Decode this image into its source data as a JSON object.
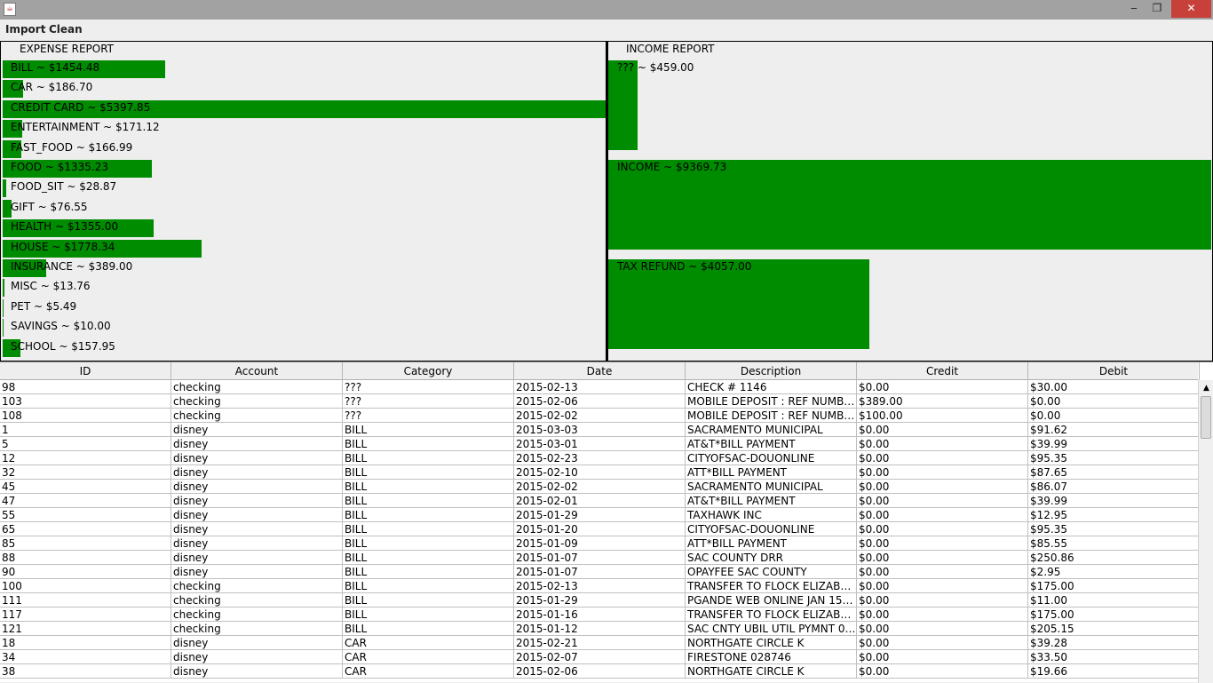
{
  "window": {
    "icon": "java-icon",
    "minimize": "‒",
    "maximize": "❐",
    "close": "✕"
  },
  "menu": [
    "Import",
    "Clean"
  ],
  "expense_report": {
    "title": "EXPENSE REPORT",
    "items": [
      {
        "label": "BILL ~ $1454.48",
        "value": 1454.48
      },
      {
        "label": "CAR ~ $186.70",
        "value": 186.7
      },
      {
        "label": "CREDIT CARD ~ $5397.85",
        "value": 5397.85
      },
      {
        "label": "ENTERTAINMENT ~ $171.12",
        "value": 171.12
      },
      {
        "label": "FAST_FOOD ~ $166.99",
        "value": 166.99
      },
      {
        "label": "FOOD ~ $1335.23",
        "value": 1335.23
      },
      {
        "label": "FOOD_SIT ~ $28.87",
        "value": 28.87
      },
      {
        "label": "GIFT ~ $76.55",
        "value": 76.55
      },
      {
        "label": "HEALTH ~ $1355.00",
        "value": 1355.0
      },
      {
        "label": "HOUSE ~ $1778.34",
        "value": 1778.34
      },
      {
        "label": "INSURANCE ~ $389.00",
        "value": 389.0
      },
      {
        "label": "MISC ~ $13.76",
        "value": 13.76
      },
      {
        "label": "PET ~ $5.49",
        "value": 5.49
      },
      {
        "label": "SAVINGS ~ $10.00",
        "value": 10.0
      },
      {
        "label": "SCHOOL ~ $157.95",
        "value": 157.95
      }
    ]
  },
  "income_report": {
    "title": "INCOME REPORT",
    "items": [
      {
        "label": "??? ~ $459.00",
        "value": 459.0
      },
      {
        "label": "INCOME ~ $9369.73",
        "value": 9369.73
      },
      {
        "label": "TAX REFUND ~ $4057.00",
        "value": 4057.0
      }
    ]
  },
  "colors": {
    "bar": "#008c00"
  },
  "table": {
    "columns": [
      "ID",
      "Account",
      "Category",
      "Date",
      "Description",
      "Credit",
      "Debit"
    ],
    "rows": [
      [
        "98",
        "checking",
        "???",
        "2015-02-13",
        "CHECK # 1146",
        "$0.00",
        "$30.00"
      ],
      [
        "103",
        "checking",
        "???",
        "2015-02-06",
        "MOBILE DEPOSIT : REF NUMBE...",
        "$389.00",
        "$0.00"
      ],
      [
        "108",
        "checking",
        "???",
        "2015-02-02",
        "MOBILE DEPOSIT : REF NUMBE...",
        "$100.00",
        "$0.00"
      ],
      [
        "1",
        "disney",
        "BILL",
        "2015-03-03",
        "SACRAMENTO MUNICIPAL",
        "$0.00",
        "$91.62"
      ],
      [
        "5",
        "disney",
        "BILL",
        "2015-03-01",
        "AT&T*BILL PAYMENT",
        "$0.00",
        "$39.99"
      ],
      [
        "12",
        "disney",
        "BILL",
        "2015-02-23",
        "CITYOFSAC-DOUONLINE",
        "$0.00",
        "$95.35"
      ],
      [
        "32",
        "disney",
        "BILL",
        "2015-02-10",
        "ATT*BILL PAYMENT",
        "$0.00",
        "$87.65"
      ],
      [
        "45",
        "disney",
        "BILL",
        "2015-02-02",
        "SACRAMENTO MUNICIPAL",
        "$0.00",
        "$86.07"
      ],
      [
        "47",
        "disney",
        "BILL",
        "2015-02-01",
        "AT&T*BILL PAYMENT",
        "$0.00",
        "$39.99"
      ],
      [
        "55",
        "disney",
        "BILL",
        "2015-01-29",
        "TAXHAWK INC",
        "$0.00",
        "$12.95"
      ],
      [
        "65",
        "disney",
        "BILL",
        "2015-01-20",
        "CITYOFSAC-DOUONLINE",
        "$0.00",
        "$95.35"
      ],
      [
        "85",
        "disney",
        "BILL",
        "2015-01-09",
        "ATT*BILL PAYMENT",
        "$0.00",
        "$85.55"
      ],
      [
        "88",
        "disney",
        "BILL",
        "2015-01-07",
        "SAC COUNTY DRR",
        "$0.00",
        "$250.86"
      ],
      [
        "90",
        "disney",
        "BILL",
        "2015-01-07",
        "OPAYFEE SAC COUNTY",
        "$0.00",
        "$2.95"
      ],
      [
        "100",
        "checking",
        "BILL",
        "2015-02-13",
        "TRANSFER TO FLOCK ELIZABE...",
        "$0.00",
        "$175.00"
      ],
      [
        "111",
        "checking",
        "BILL",
        "2015-01-29",
        "PGANDE WEB ONLINE JAN 15 2...",
        "$0.00",
        "$11.00"
      ],
      [
        "117",
        "checking",
        "BILL",
        "2015-01-16",
        "TRANSFER TO FLOCK ELIZABE...",
        "$0.00",
        "$175.00"
      ],
      [
        "121",
        "checking",
        "BILL",
        "2015-01-12",
        "SAC CNTY UBIL UTIL PYMNT 00...",
        "$0.00",
        "$205.15"
      ],
      [
        "18",
        "disney",
        "CAR",
        "2015-02-21",
        "NORTHGATE CIRCLE K",
        "$0.00",
        "$39.28"
      ],
      [
        "34",
        "disney",
        "CAR",
        "2015-02-07",
        "FIRESTONE 028746",
        "$0.00",
        "$33.50"
      ],
      [
        "38",
        "disney",
        "CAR",
        "2015-02-06",
        "NORTHGATE CIRCLE K",
        "$0.00",
        "$19.66"
      ]
    ]
  }
}
